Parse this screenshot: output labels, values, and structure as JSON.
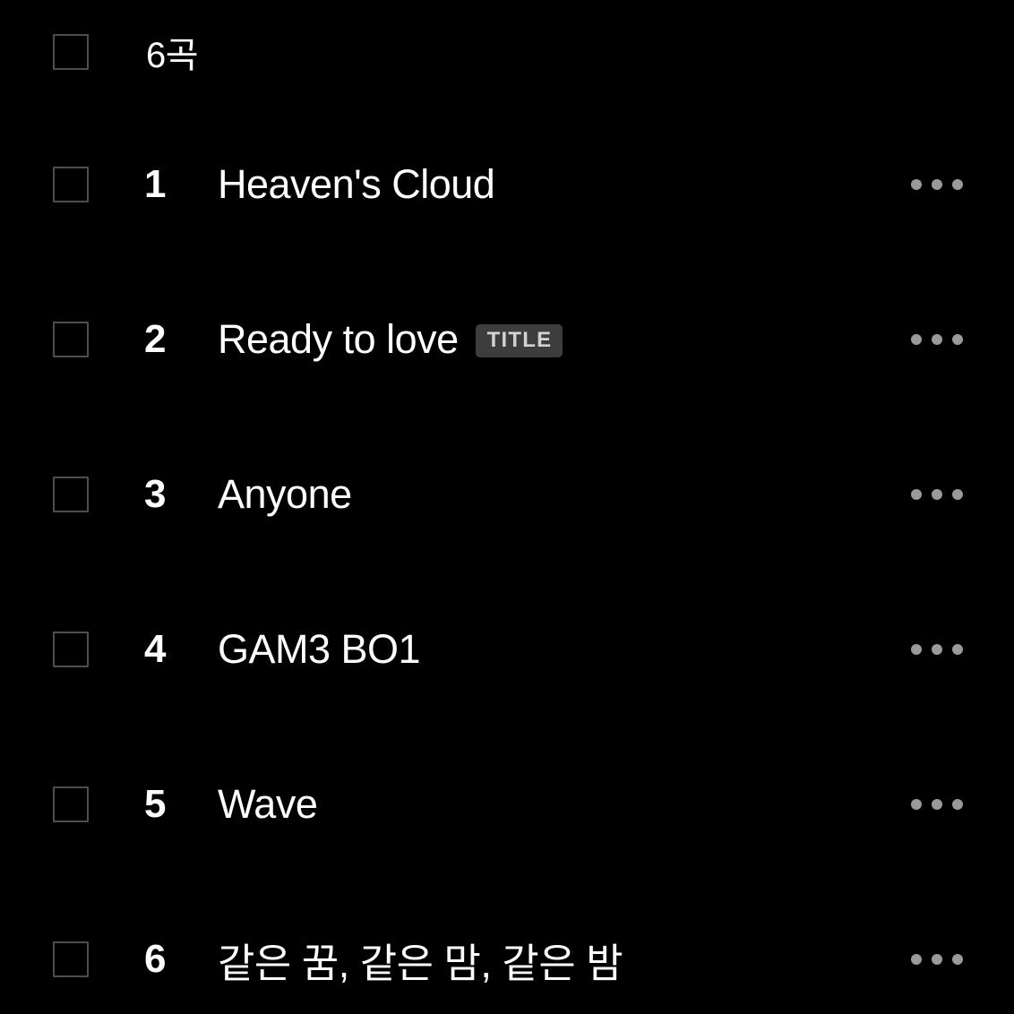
{
  "theme": {
    "background": "#000000",
    "text_primary": "#ffffff",
    "checkbox_border": "#4e4e4e",
    "badge_background": "#3d3d3d",
    "badge_text": "#d2d2d2",
    "dot_color": "#9a9a9a"
  },
  "header": {
    "count_label": "6곡",
    "checkbox_checked": false
  },
  "more_icon_name": "more-horizontal-icon",
  "tracks": [
    {
      "number": "1",
      "title": "Heaven's Cloud",
      "badge": "",
      "checked": false
    },
    {
      "number": "2",
      "title": "Ready to love",
      "badge": "TITLE",
      "checked": false
    },
    {
      "number": "3",
      "title": "Anyone",
      "badge": "",
      "checked": false
    },
    {
      "number": "4",
      "title": "GAM3 BO1",
      "badge": "",
      "checked": false
    },
    {
      "number": "5",
      "title": "Wave",
      "badge": "",
      "checked": false
    },
    {
      "number": "6",
      "title": "같은 꿈, 같은 맘, 같은 밤",
      "badge": "",
      "checked": false
    }
  ]
}
